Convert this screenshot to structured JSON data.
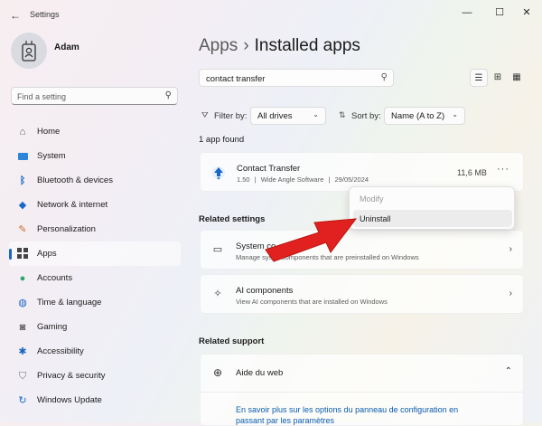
{
  "window": {
    "title": "Settings",
    "back_icon": "back-arrow-icon",
    "controls": [
      "minimize-icon",
      "maximize-icon",
      "close-icon"
    ]
  },
  "user": {
    "name": "Adam"
  },
  "sidebar": {
    "search_placeholder": "Find a setting",
    "items": [
      {
        "label": "Home",
        "icon": "home-icon",
        "active": false
      },
      {
        "label": "System",
        "icon": "system-icon",
        "active": false
      },
      {
        "label": "Bluetooth & devices",
        "icon": "bluetooth-icon",
        "active": false
      },
      {
        "label": "Network & internet",
        "icon": "wifi-icon",
        "active": false
      },
      {
        "label": "Personalization",
        "icon": "brush-icon",
        "active": false
      },
      {
        "label": "Apps",
        "icon": "apps-icon",
        "active": true
      },
      {
        "label": "Accounts",
        "icon": "accounts-icon",
        "active": false
      },
      {
        "label": "Time & language",
        "icon": "globe-clock-icon",
        "active": false
      },
      {
        "label": "Gaming",
        "icon": "gamepad-icon",
        "active": false
      },
      {
        "label": "Accessibility",
        "icon": "accessibility-icon",
        "active": false
      },
      {
        "label": "Privacy & security",
        "icon": "shield-icon",
        "active": false
      },
      {
        "label": "Windows Update",
        "icon": "update-icon",
        "active": false
      }
    ]
  },
  "main": {
    "breadcrumb": {
      "parent": "Apps",
      "separator": "›",
      "current": "Installed apps"
    },
    "search_value": "contact transfer",
    "filter": {
      "label": "Filter by:",
      "value": "All drives"
    },
    "sort": {
      "label": "Sort by:",
      "value": "Name (A to Z)"
    },
    "count_text": "1 app found",
    "apps": [
      {
        "name": "Contact Transfer",
        "version": "1.50",
        "publisher": "Wide Angle Software",
        "date": "29/05/2024",
        "size": "11,6 MB",
        "more": "···"
      }
    ],
    "context_menu": {
      "modify": "Modify",
      "uninstall": "Uninstall"
    },
    "related_settings": {
      "heading": "Related settings",
      "items": [
        {
          "title": "System co",
          "subtitle": "Manage sys     components that are preinstalled on Windows",
          "icon": "system-components-icon"
        },
        {
          "title": "AI components",
          "subtitle": "View AI components that are installed on Windows",
          "icon": "sparkle-icon"
        }
      ]
    },
    "related_support": {
      "heading": "Related support",
      "title": "Aide du web",
      "link": "En savoir plus sur les options du panneau de configuration en passant par les paramètres"
    }
  },
  "colors": {
    "accent": "#1a67c5",
    "annotation_arrow": "#e0211f",
    "link": "#0b5cad"
  }
}
